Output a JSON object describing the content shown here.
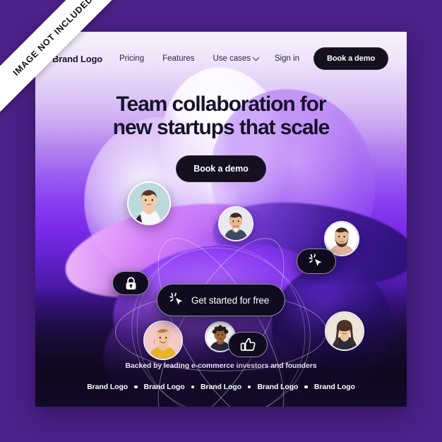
{
  "watermark": {
    "text": "IMAGE NOT INCLUDED"
  },
  "colors": {
    "page_background": "#4b2289",
    "card_dark": "#100824",
    "button_dark": "#14101f",
    "headline_text": "#17122b",
    "accent_violet": "#8a3ff0"
  },
  "nav": {
    "brand": "Brand Logo",
    "links": [
      {
        "label": "Pricing",
        "icon": ""
      },
      {
        "label": "Features",
        "icon": ""
      },
      {
        "label": "Use cases",
        "icon": "chevron-down-icon"
      }
    ],
    "signin_label": "Sign in",
    "cta_label": "Book a demo"
  },
  "hero": {
    "headline_line1": "Team collaboration for",
    "headline_line2": "new startups that scale",
    "cta_label": "Book a demo"
  },
  "graphic": {
    "main_cta_label": "Get started for free",
    "main_cta_icon": "cursor-click-icon",
    "pills": [
      {
        "name": "lock-icon",
        "label": ""
      },
      {
        "name": "cursor-click-icon",
        "label": ""
      },
      {
        "name": "thumbs-up-icon",
        "label": ""
      }
    ],
    "avatars": [
      {
        "name": "avatar-woman-short-hair",
        "bg": "#bcd9de"
      },
      {
        "name": "avatar-man-center",
        "bg": "#e9e9ee"
      },
      {
        "name": "avatar-man-beard",
        "bg": "#ffffff"
      },
      {
        "name": "avatar-woman-blonde",
        "bg": "#f6c9c9"
      },
      {
        "name": "avatar-woman-curly",
        "bg": "#ffffff"
      },
      {
        "name": "avatar-woman-long-hair",
        "bg": "#efe6da"
      }
    ]
  },
  "footer": {
    "backed_text": "Backed by leading e-commerce investors and founders",
    "logos": [
      "Brand Logo",
      "Brand Logo",
      "Brand Logo",
      "Brand Logo",
      "Brand Logo"
    ]
  }
}
